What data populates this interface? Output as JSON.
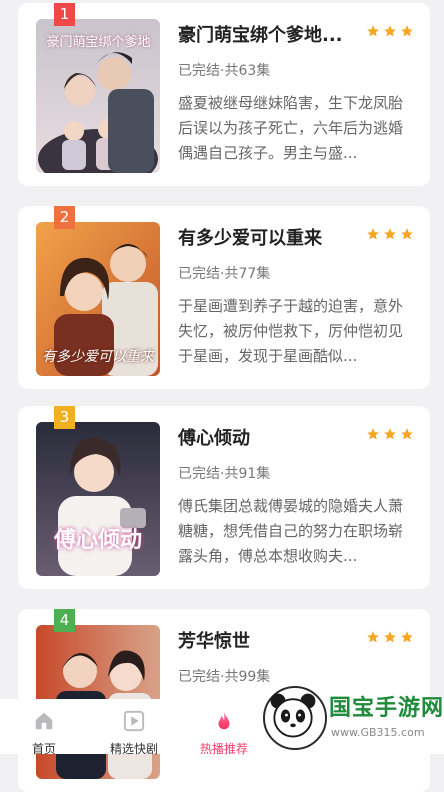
{
  "dramas": [
    {
      "rank": "1",
      "rank_color": "#f04848",
      "title": "豪门萌宝绑个爹地...",
      "status": "已完结·共63集",
      "description": "盛夏被继母继妹陷害，生下龙凤胎后误以为孩子死亡，六年后为逃婚偶遇自己孩子。男主与盛...",
      "rating_stars": 3,
      "poster_caption": "豪门萌宝绑个爹地",
      "poster_icon": "couple-with-twins-poster"
    },
    {
      "rank": "2",
      "rank_color": "#f07040",
      "title": "有多少爱可以重来",
      "status": "已完结·共77集",
      "description": "于星画遭到养子于越的迫害，意外失忆，被厉仲恺救下，厉仲恺初见于星画，发现于星画酷似...",
      "rating_stars": 3,
      "poster_caption": "有多少爱可以重来",
      "poster_icon": "couple-warm-poster"
    },
    {
      "rank": "3",
      "rank_color": "#f0b020",
      "title": "傅心倾动",
      "status": "已完结·共91集",
      "description": "傅氏集团总裁傅晏城的隐婚夫人萧糖糖，想凭借自己的努力在职场崭露头角，傅总本想收购夫...",
      "rating_stars": 3,
      "poster_caption": "傅心倾动",
      "poster_icon": "woman-in-white-poster"
    },
    {
      "rank": "4",
      "rank_color": "#4caf50",
      "title": "芳华惊世",
      "status": "已完结·共99集",
      "description": "",
      "rating_stars": 3,
      "poster_caption": "",
      "poster_icon": "couple-poster"
    }
  ],
  "tabbar": {
    "items": [
      {
        "label": "首页",
        "icon": "home-icon"
      },
      {
        "label": "精选快剧",
        "icon": "play-icon"
      },
      {
        "label": "热播推荐",
        "icon": "flame-icon",
        "active": true
      }
    ]
  },
  "watermark": {
    "text": "国宝手游网",
    "url": "www.GB315.com",
    "icon": "panda-icon"
  },
  "colors": {
    "star": "#f5a623",
    "accent": "#ff3a6b",
    "background": "#f1f1f3"
  }
}
